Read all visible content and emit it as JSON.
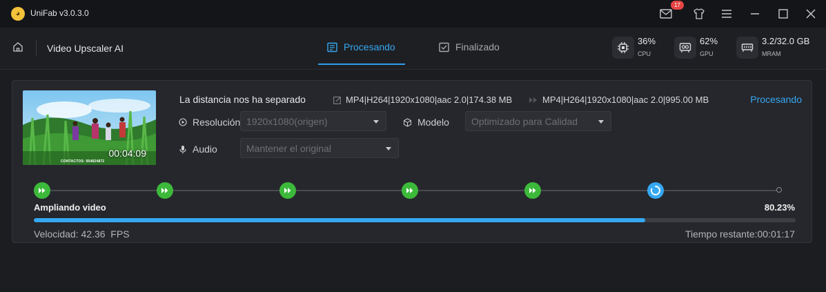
{
  "window": {
    "title": "UniFab v3.0.3.0",
    "notification_count": "17",
    "icons": [
      "mail-icon",
      "shirt-icon",
      "menu-icon",
      "minimize-icon",
      "maximize-icon",
      "close-icon"
    ]
  },
  "nav": {
    "module_title": "Video Upscaler AI",
    "tabs": [
      {
        "label": "Procesando",
        "active": true
      },
      {
        "label": "Finalizado",
        "active": false
      }
    ]
  },
  "metrics": [
    {
      "value": "36%",
      "label": "CPU",
      "icon": "cpu-icon"
    },
    {
      "value": "62%",
      "label": "GPU",
      "icon": "gpu-icon"
    },
    {
      "value": "3.2/32.0 GB",
      "label": "MRAM",
      "icon": "memory-icon"
    }
  ],
  "task": {
    "title": "La distancia nos ha separado",
    "duration": "00:04:09",
    "thumbnail_caption": "CONTACTOS: 954824872",
    "input_format": "MP4|H264|1920x1080|aac 2.0|174.38 MB",
    "output_format": "MP4|H264|1920x1080|aac 2.0|995.00 MB",
    "status": "Procesando",
    "resolution_label": "Resolución",
    "resolution_value": "1920x1080(origen)",
    "model_label": "Modelo",
    "model_value": "Optimizado para Calidad",
    "audio_label": "Audio",
    "audio_value": "Mantener el original",
    "steps_completed": 5,
    "phase": "Ampliando video",
    "progress_percent": 80.23,
    "progress_text": "80.23%",
    "speed": "Velocidad: 42.36  FPS",
    "remaining": "Tiempo restante:00:01:17"
  },
  "colors": {
    "accent": "#35a8f2",
    "step_done": "#3cb93a",
    "badge": "#e64545",
    "background": "#1c1d21"
  }
}
